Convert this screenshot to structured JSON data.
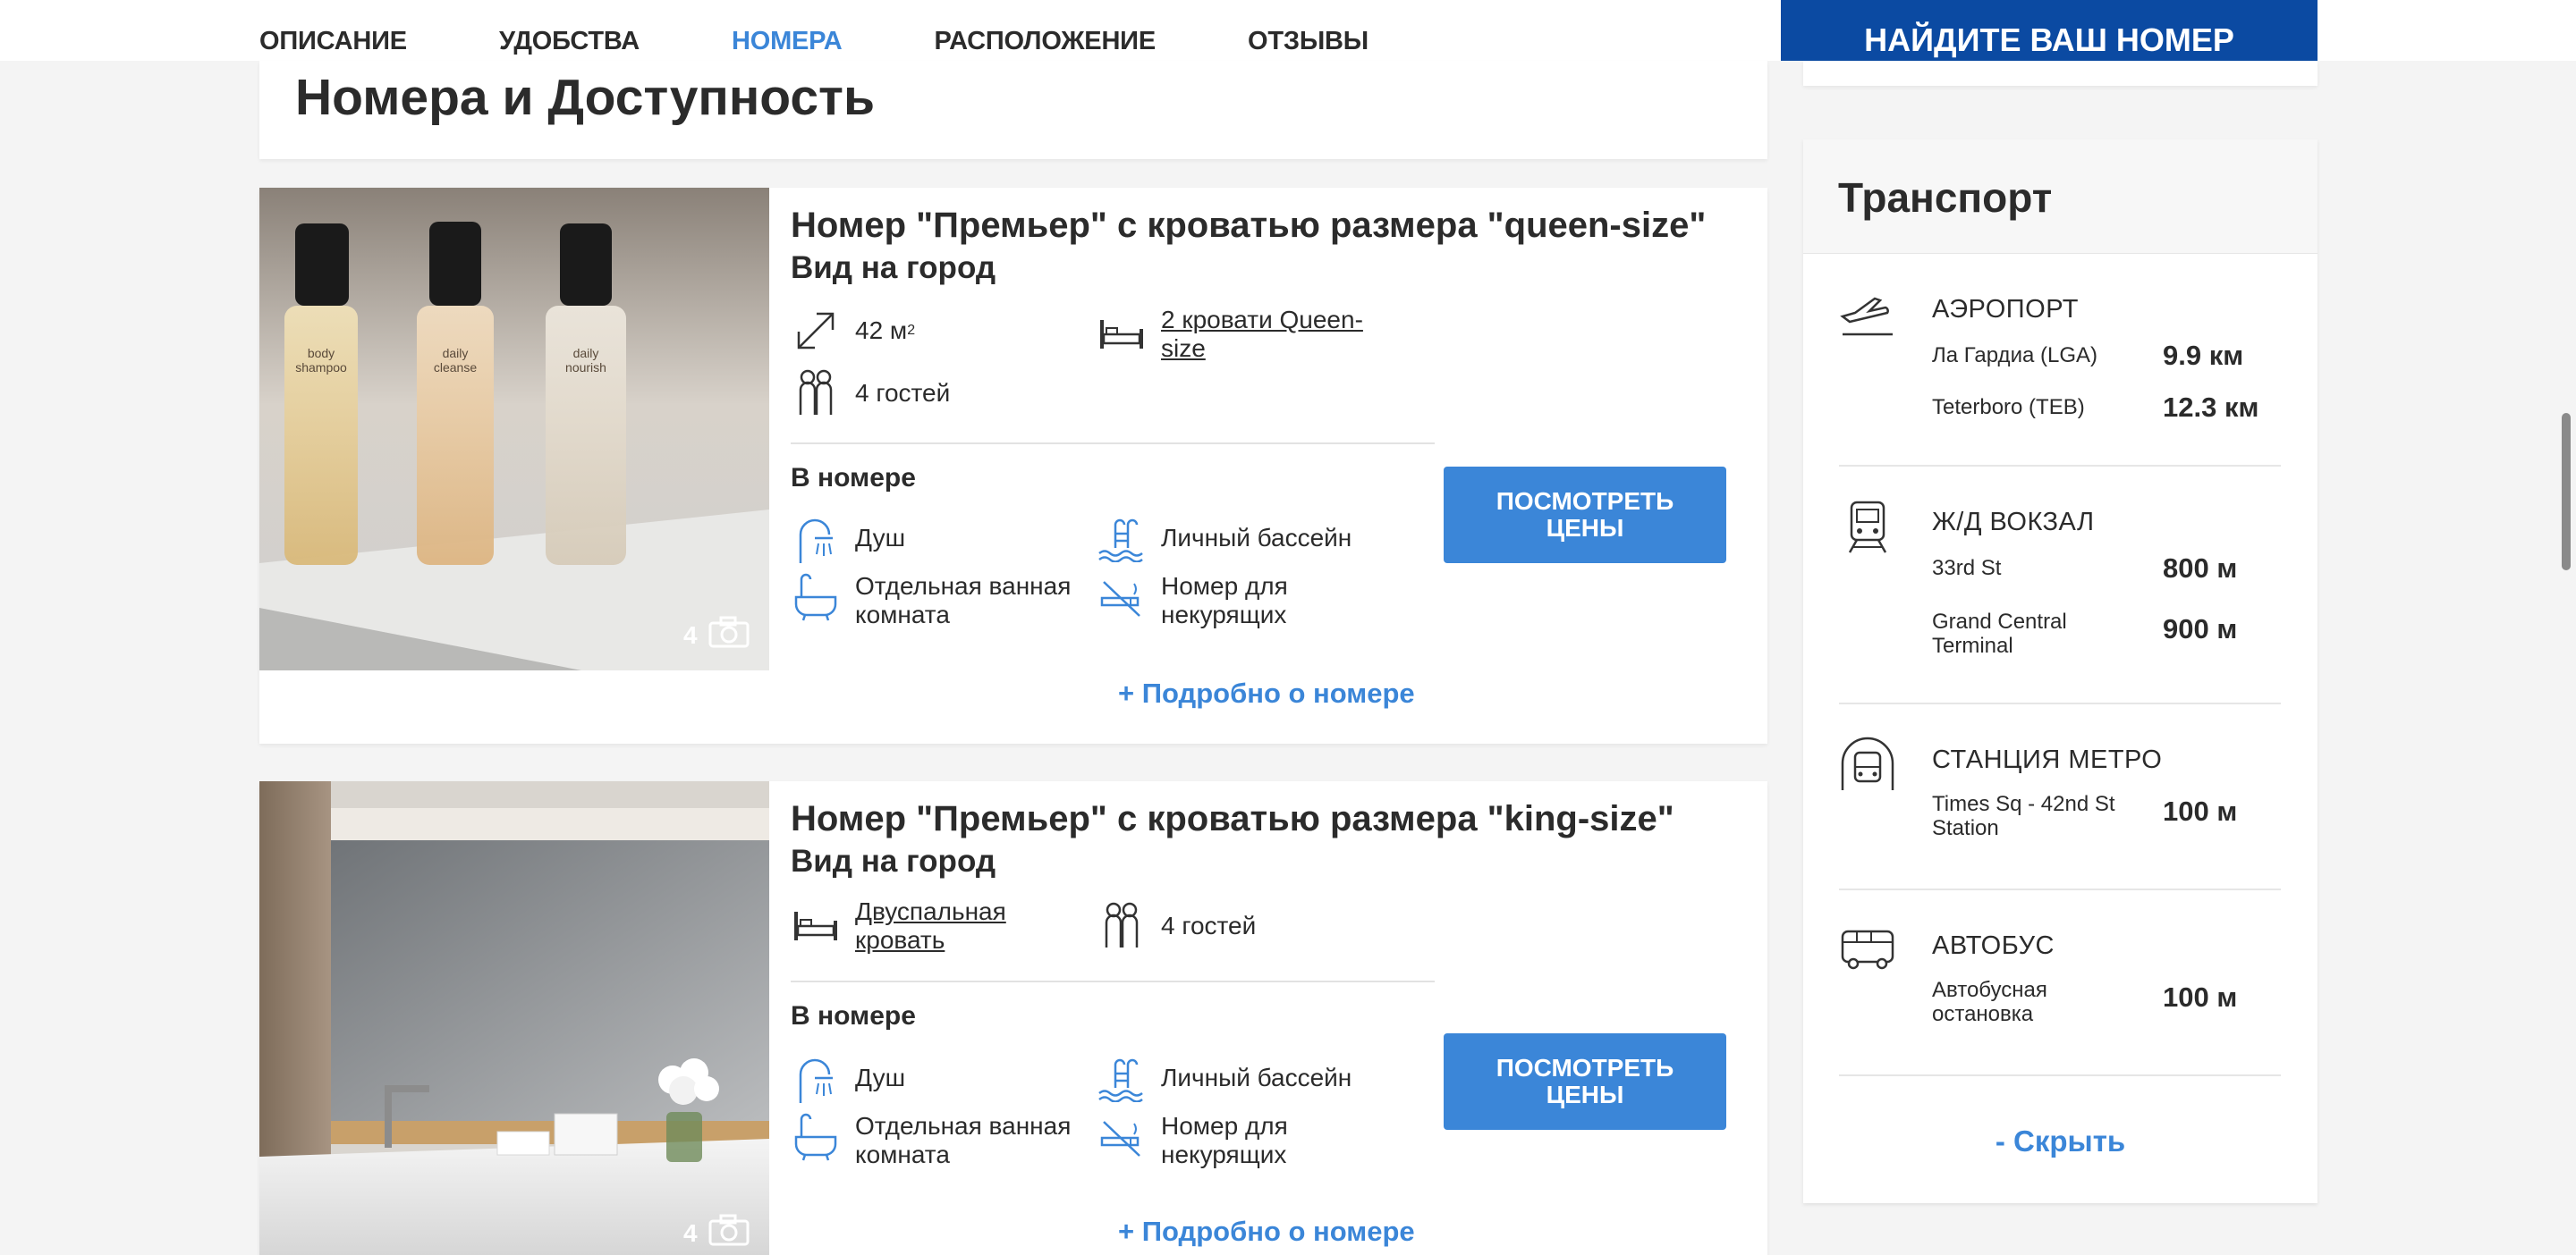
{
  "nav": {
    "tabs": [
      {
        "label": "ОПИСАНИЕ",
        "active": false
      },
      {
        "label": "УДОБСТВА",
        "active": false
      },
      {
        "label": "НОМЕРА",
        "active": true
      },
      {
        "label": "РАСПОЛОЖЕНИЕ",
        "active": false
      },
      {
        "label": "ОТЗЫВЫ",
        "active": false
      }
    ],
    "find_room_button": "НАЙДИТЕ ВАШ НОМЕР"
  },
  "section_title": "Номера и Доступность",
  "rooms": [
    {
      "name": "Номер \"Премьер\" с кроватью размера \"queen-size\"",
      "view": "Вид на город",
      "photo_count": "4",
      "area": "42 м",
      "area_sup": "2",
      "bed": "2 кровати Queen-size",
      "guests": "4 гостей",
      "in_room_label": "В номере",
      "amenities": [
        "Душ",
        "Личный бассейн",
        "Отдельная ванная комната",
        "Номер для некурящих"
      ],
      "price_button": "ПОСМОТРЕТЬ ЦЕНЫ",
      "more_link": "+ Подробно о номере"
    },
    {
      "name": "Номер \"Премьер\" с кроватью размера \"king-size\"",
      "view": "Вид на город",
      "photo_count": "4",
      "bed": "Двуспальная кровать",
      "guests": "4 гостей",
      "in_room_label": "В номере",
      "amenities": [
        "Душ",
        "Личный бассейн",
        "Отдельная ванная комната",
        "Номер для некурящих"
      ],
      "price_button": "ПОСМОТРЕТЬ ЦЕНЫ",
      "more_link": "+ Подробно о номере"
    }
  ],
  "transport": {
    "title": "Транспорт",
    "groups": [
      {
        "title": "АЭРОПОРТ",
        "icon": "plane-icon",
        "items": [
          {
            "name": "Ла Гардиа (LGA)",
            "distance": "9.9 км"
          },
          {
            "name": "Teterboro (TEB)",
            "distance": "12.3 км"
          }
        ]
      },
      {
        "title": "Ж/Д ВОКЗАЛ",
        "icon": "train-icon",
        "items": [
          {
            "name": "33rd St",
            "distance": "800 м"
          },
          {
            "name": "Grand Central Terminal",
            "distance": "900 м"
          }
        ]
      },
      {
        "title": "СТАНЦИЯ МЕТРО",
        "icon": "metro-icon",
        "items": [
          {
            "name": "Times Sq - 42nd St Station",
            "distance": "100 м"
          }
        ]
      },
      {
        "title": "АВТОБУС",
        "icon": "bus-icon",
        "items": [
          {
            "name": "Автобусная остановка",
            "distance": "100 м"
          }
        ]
      }
    ],
    "hide_link": "- Скрыть"
  },
  "colors": {
    "accent": "#3b86d8",
    "header_blue": "#0b4aa2",
    "text": "#2b2b2b"
  }
}
